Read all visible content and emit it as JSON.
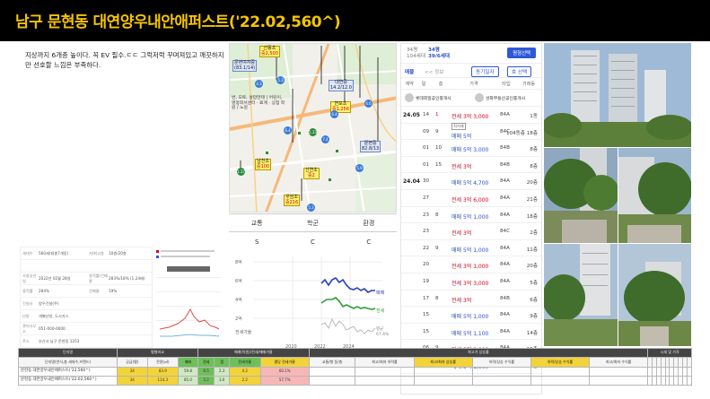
{
  "title": "남구 문현동 대연양우내안애퍼스트('22.02,560^)",
  "memo": "지상까지 6개층 높이다. 꼭 EV 필수.ㄷㄷ 그럭저럭 꾸며져있고 깨끗하지만 선호할 느낌은 부족하다.",
  "map": {
    "pins": [
      {
        "name": "선동초",
        "grade": "중2,500",
        "val": "31.5",
        "extra": "문현여자중",
        "extra_val": "(83.1/14)"
      },
      {
        "name": "대연중",
        "val": "14.2/12.0"
      },
      {
        "name": "연포초",
        "grade": "중1,256",
        "val": "8.6/5"
      },
      {
        "name": "문현중",
        "val": "82.8/13"
      },
      {
        "name": "남천초",
        "grade": "중100",
        "val": "/812"
      },
      {
        "name": "신연초",
        "grade": "중2",
        "val": "/8/4"
      },
      {
        "name": "우암초",
        "grade": "중216",
        "val": "/8/19"
      }
    ],
    "numbers": [
      "4.3",
      "5.3",
      "6.4",
      "6.6",
      "7.4",
      "5.9",
      "5.9",
      "5.33",
      "1.17",
      "5.3",
      "4.0",
      "6.4"
    ],
    "building_label": "번, 모토, 살압면테 | 어린이, 명정회서센터 · 료계 · 상점 학원 / 노원"
  },
  "grades": {
    "headers": [
      "교통",
      "학군",
      "환경"
    ],
    "values": [
      "S",
      "C",
      "C"
    ]
  },
  "listing": {
    "py_label": "34평",
    "py_sub": "104세대",
    "py2_label": "34평",
    "py2_sub": "39/6세대",
    "button": "평형선택",
    "filter1": "매물",
    "filter2": "<< 정보",
    "badge1": "동기일자",
    "badge2": "호 선택",
    "head": [
      "계약",
      "일",
      "층",
      "가격",
      "타입",
      "거래동"
    ],
    "agent1": "롯데회일공인중개사",
    "agent2": "성화부동산공인중개사",
    "rows": [
      {
        "ym": "24.05",
        "d": "14",
        "f": "1",
        "price": "전세 3억 3,000",
        "area": "84A",
        "dong": "1동",
        "pc": "red",
        "fc": "red"
      },
      {
        "ym": "",
        "d": "09",
        "f": "9",
        "price": "매매 5억",
        "area": "84C",
        "dong": "104동층 18층",
        "pc": "blue",
        "fc": "",
        "stamp": "직거래"
      },
      {
        "ym": "",
        "d": "01",
        "f": "10",
        "price": "매매 5억 3,000",
        "area": "84B",
        "dong": "8층",
        "pc": "blue",
        "fc": ""
      },
      {
        "ym": "",
        "d": "01",
        "f": "15",
        "price": "전세 3억",
        "area": "84B",
        "dong": "8층",
        "pc": "red",
        "fc": ""
      },
      {
        "ym": "24.04",
        "d": "30",
        "f": "",
        "price": "매매 5억 4,700",
        "area": "84A",
        "dong": "20층",
        "pc": "blue",
        "fc": ""
      },
      {
        "ym": "",
        "d": "27",
        "f": "",
        "price": "전세 3억 6,000",
        "area": "84A",
        "dong": "21층",
        "pc": "red",
        "fc": ""
      },
      {
        "ym": "",
        "d": "23",
        "f": "8",
        "price": "매매 5억 1,000",
        "area": "84A",
        "dong": "18층",
        "pc": "blue",
        "fc": ""
      },
      {
        "ym": "",
        "d": "23",
        "f": "",
        "price": "전세 3억",
        "area": "84C",
        "dong": "2층",
        "pc": "red",
        "fc": ""
      },
      {
        "ym": "",
        "d": "22",
        "f": "9",
        "price": "매매 5억 1,000",
        "area": "84A",
        "dong": "11층",
        "pc": "blue",
        "fc": ""
      },
      {
        "ym": "",
        "d": "20",
        "f": "",
        "price": "전세 3억 1,000",
        "area": "84A",
        "dong": "20층",
        "pc": "red",
        "fc": ""
      },
      {
        "ym": "",
        "d": "19",
        "f": "",
        "price": "전세 3억 3,000",
        "area": "84A",
        "dong": "5층",
        "pc": "red",
        "fc": ""
      },
      {
        "ym": "",
        "d": "17",
        "f": "8",
        "price": "전세 3억",
        "area": "84B",
        "dong": "6층",
        "pc": "red",
        "fc": ""
      },
      {
        "ym": "",
        "d": "15",
        "f": "",
        "price": "매매 5억 1,000",
        "area": "84A",
        "dong": "9층",
        "pc": "blue",
        "fc": ""
      },
      {
        "ym": "",
        "d": "15",
        "f": "",
        "price": "매매 5억 1,100",
        "area": "84A",
        "dong": "14층",
        "pc": "blue",
        "fc": ""
      },
      {
        "ym": "",
        "d": "06",
        "f": "9",
        "price": "전세 3억 2,000",
        "area": "84A",
        "dong": "15층",
        "pc": "red",
        "fc": ""
      },
      {
        "ym": "",
        "d": "05",
        "f": "",
        "price": "매매 5억 1,000",
        "area": "84A",
        "dong": "3층",
        "pc": "blue",
        "fc": ""
      }
    ]
  },
  "info": {
    "rows": [
      [
        "세대수",
        "560세대(총7개동)",
        "저/최고층",
        "10층/20층"
      ],
      [
        "",
        "",
        "",
        ""
      ],
      [
        "사용승인일",
        "2022년 02월 28일",
        "용적률/건폐율",
        "283%/18% (1.24배)"
      ],
      [
        "용적률",
        "284%",
        "건폐율",
        "19%"
      ],
      [
        "건설사",
        "양우건설(주)",
        "",
        ""
      ],
      [
        "난방",
        "개별난방, 도시가스",
        "",
        ""
      ],
      [
        "관리사무소",
        "051-000-0000",
        "",
        ""
      ],
      [
        "주소",
        "부산시 남구 문현동 1253",
        "",
        ""
      ],
      [
        "면적",
        "84A㎡, 87A㎡, 112C㎡, 114A㎡, 114B㎡",
        "",
        ""
      ]
    ]
  },
  "price_chart": {
    "y_labels": [
      "8억",
      "6억",
      "4억",
      "2억"
    ],
    "x_labels": [
      "2020",
      "2022",
      "2024"
    ],
    "legend_sale": "매매",
    "legend_jeonse": "전세",
    "legend_ratio": "전세가율",
    "ratio_label": "평균",
    "ratio_val": "67.4%",
    "colors": {
      "sale": "#2b3fbf",
      "jeonse": "#2e9e3c",
      "ratio": "#999999"
    }
  },
  "bottom_table": {
    "top_headers": [
      "단지명",
      "평형비교",
      "매매(억원)/전세/매매가율",
      "최고가 상승률",
      "시세 및 가격"
    ],
    "hdr_cells": [
      "단지명(연식,총 세대수,브랜드)",
      "공급(평)",
      "전용(㎡)",
      "매매",
      "전세",
      "갭",
      "전세가율",
      "평당 전세가율",
      "교통/향 동/층",
      "최고/최저 하락률",
      "최고/최저 상승률",
      "하락/상승 수익률",
      "하락/상승 수익률",
      "최고/최저 수익률"
    ],
    "rows": [
      {
        "name": "문현동 대연양우내안애퍼스트('22,560^)",
        "a": "34",
        "b": "83.9",
        "c": "59.8",
        "d": "6.5",
        "e": "2.3",
        "f": "4.2",
        "g": "60.1%"
      },
      {
        "name": "문현동 대연양우내안애퍼스트('22.02,560^)",
        "a": "34",
        "b": "114.3",
        "c": "85.0",
        "d": "5.2",
        "e": "3.0",
        "f": "2.2",
        "g": "57.7%"
      }
    ]
  }
}
